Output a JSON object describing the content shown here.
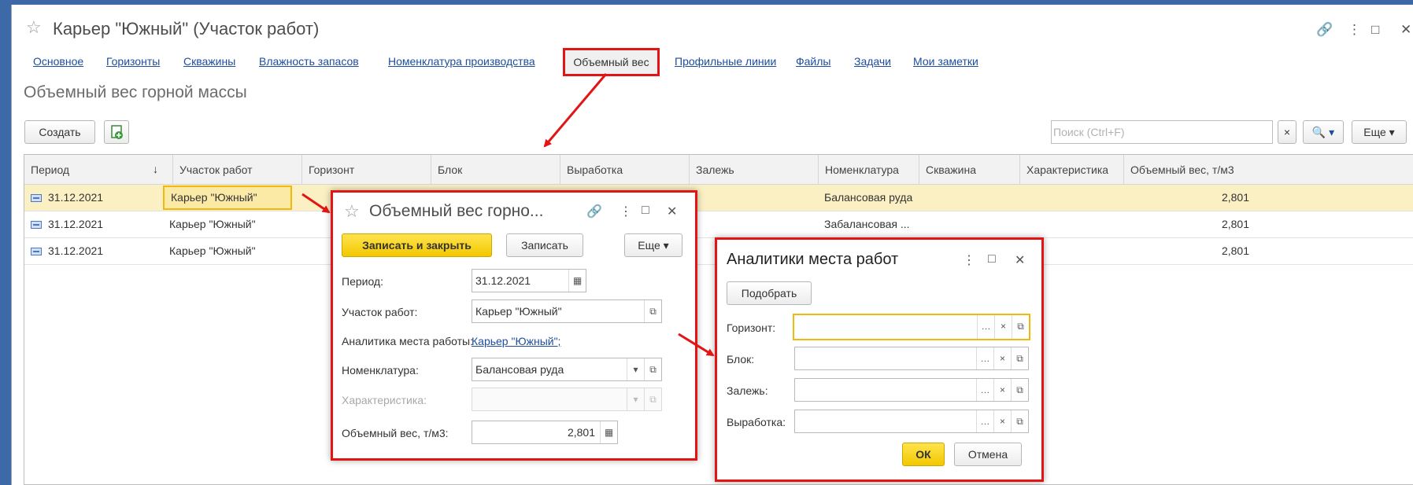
{
  "window": {
    "title": "Карьер \"Южный\" (Участок работ)",
    "star": "☆",
    "controls": [
      "🔗",
      "⋮",
      "□",
      "✕"
    ]
  },
  "tabs": [
    {
      "label": "Основное"
    },
    {
      "label": "Горизонты"
    },
    {
      "label": "Скважины"
    },
    {
      "label": "Влажность запасов"
    },
    {
      "label": "Номенклатура производства"
    },
    {
      "label": "Объемный вес"
    },
    {
      "label": "Профильные линии"
    },
    {
      "label": "Файлы"
    },
    {
      "label": "Задачи"
    },
    {
      "label": "Мои заметки"
    }
  ],
  "section_title": "Объемный вес горной массы",
  "toolbar": {
    "create_label": "Создать",
    "search_placeholder": "Поиск (Ctrl+F)",
    "search_clear": "×",
    "search_btn": "🔍 ▾",
    "more_label": "Еще ▾"
  },
  "table": {
    "columns": [
      "Период",
      "Участок работ",
      "Горизонт",
      "Блок",
      "Выработка",
      "Залежь",
      "Номенклатура",
      "Скважина",
      "Характеристика",
      "Объемный вес, т/м3"
    ],
    "sort_arrow": "↓",
    "rows": [
      {
        "period": "31.12.2021",
        "site": "Карьер \"Южный\"",
        "nomen": "Балансовая руда",
        "weight": "2,801"
      },
      {
        "period": "31.12.2021",
        "site": "Карьер \"Южный\"",
        "nomen": "Забалансовая ...",
        "weight": "2,801"
      },
      {
        "period": "31.12.2021",
        "site": "Карьер \"Южный\"",
        "nomen": "",
        "weight": "2,801"
      }
    ]
  },
  "dialog1": {
    "title": "Объемный вес горно...",
    "controls": [
      "🔗",
      "⋮",
      "□",
      "✕"
    ],
    "save_close": "Записать и закрыть",
    "save": "Записать",
    "more": "Еще ▾",
    "period_label": "Период:",
    "period_value": "31.12.2021",
    "site_label": "Участок работ:",
    "site_value": "Карьер \"Южный\"",
    "analytics_label": "Аналитика места работы:",
    "analytics_value": "Карьер \"Южный\";",
    "nomen_label": "Номенклатура:",
    "nomen_value": "Балансовая руда",
    "char_label": "Характеристика:",
    "weight_label": "Объемный вес, т/м3:",
    "weight_value": "2,801"
  },
  "dialog2": {
    "title": "Аналитики места работ",
    "controls": [
      "⋮",
      "□",
      "✕"
    ],
    "pick": "Подобрать",
    "fields": [
      {
        "label": "Горизонт:"
      },
      {
        "label": "Блок:"
      },
      {
        "label": "Залежь:"
      },
      {
        "label": "Выработка:"
      }
    ],
    "ok": "ОК",
    "cancel": "Отмена"
  },
  "colors": {
    "highlight": "#e21515",
    "accent_yellow": "#f2c800",
    "link": "#1c4d9e",
    "selection": "#fbefc4"
  }
}
